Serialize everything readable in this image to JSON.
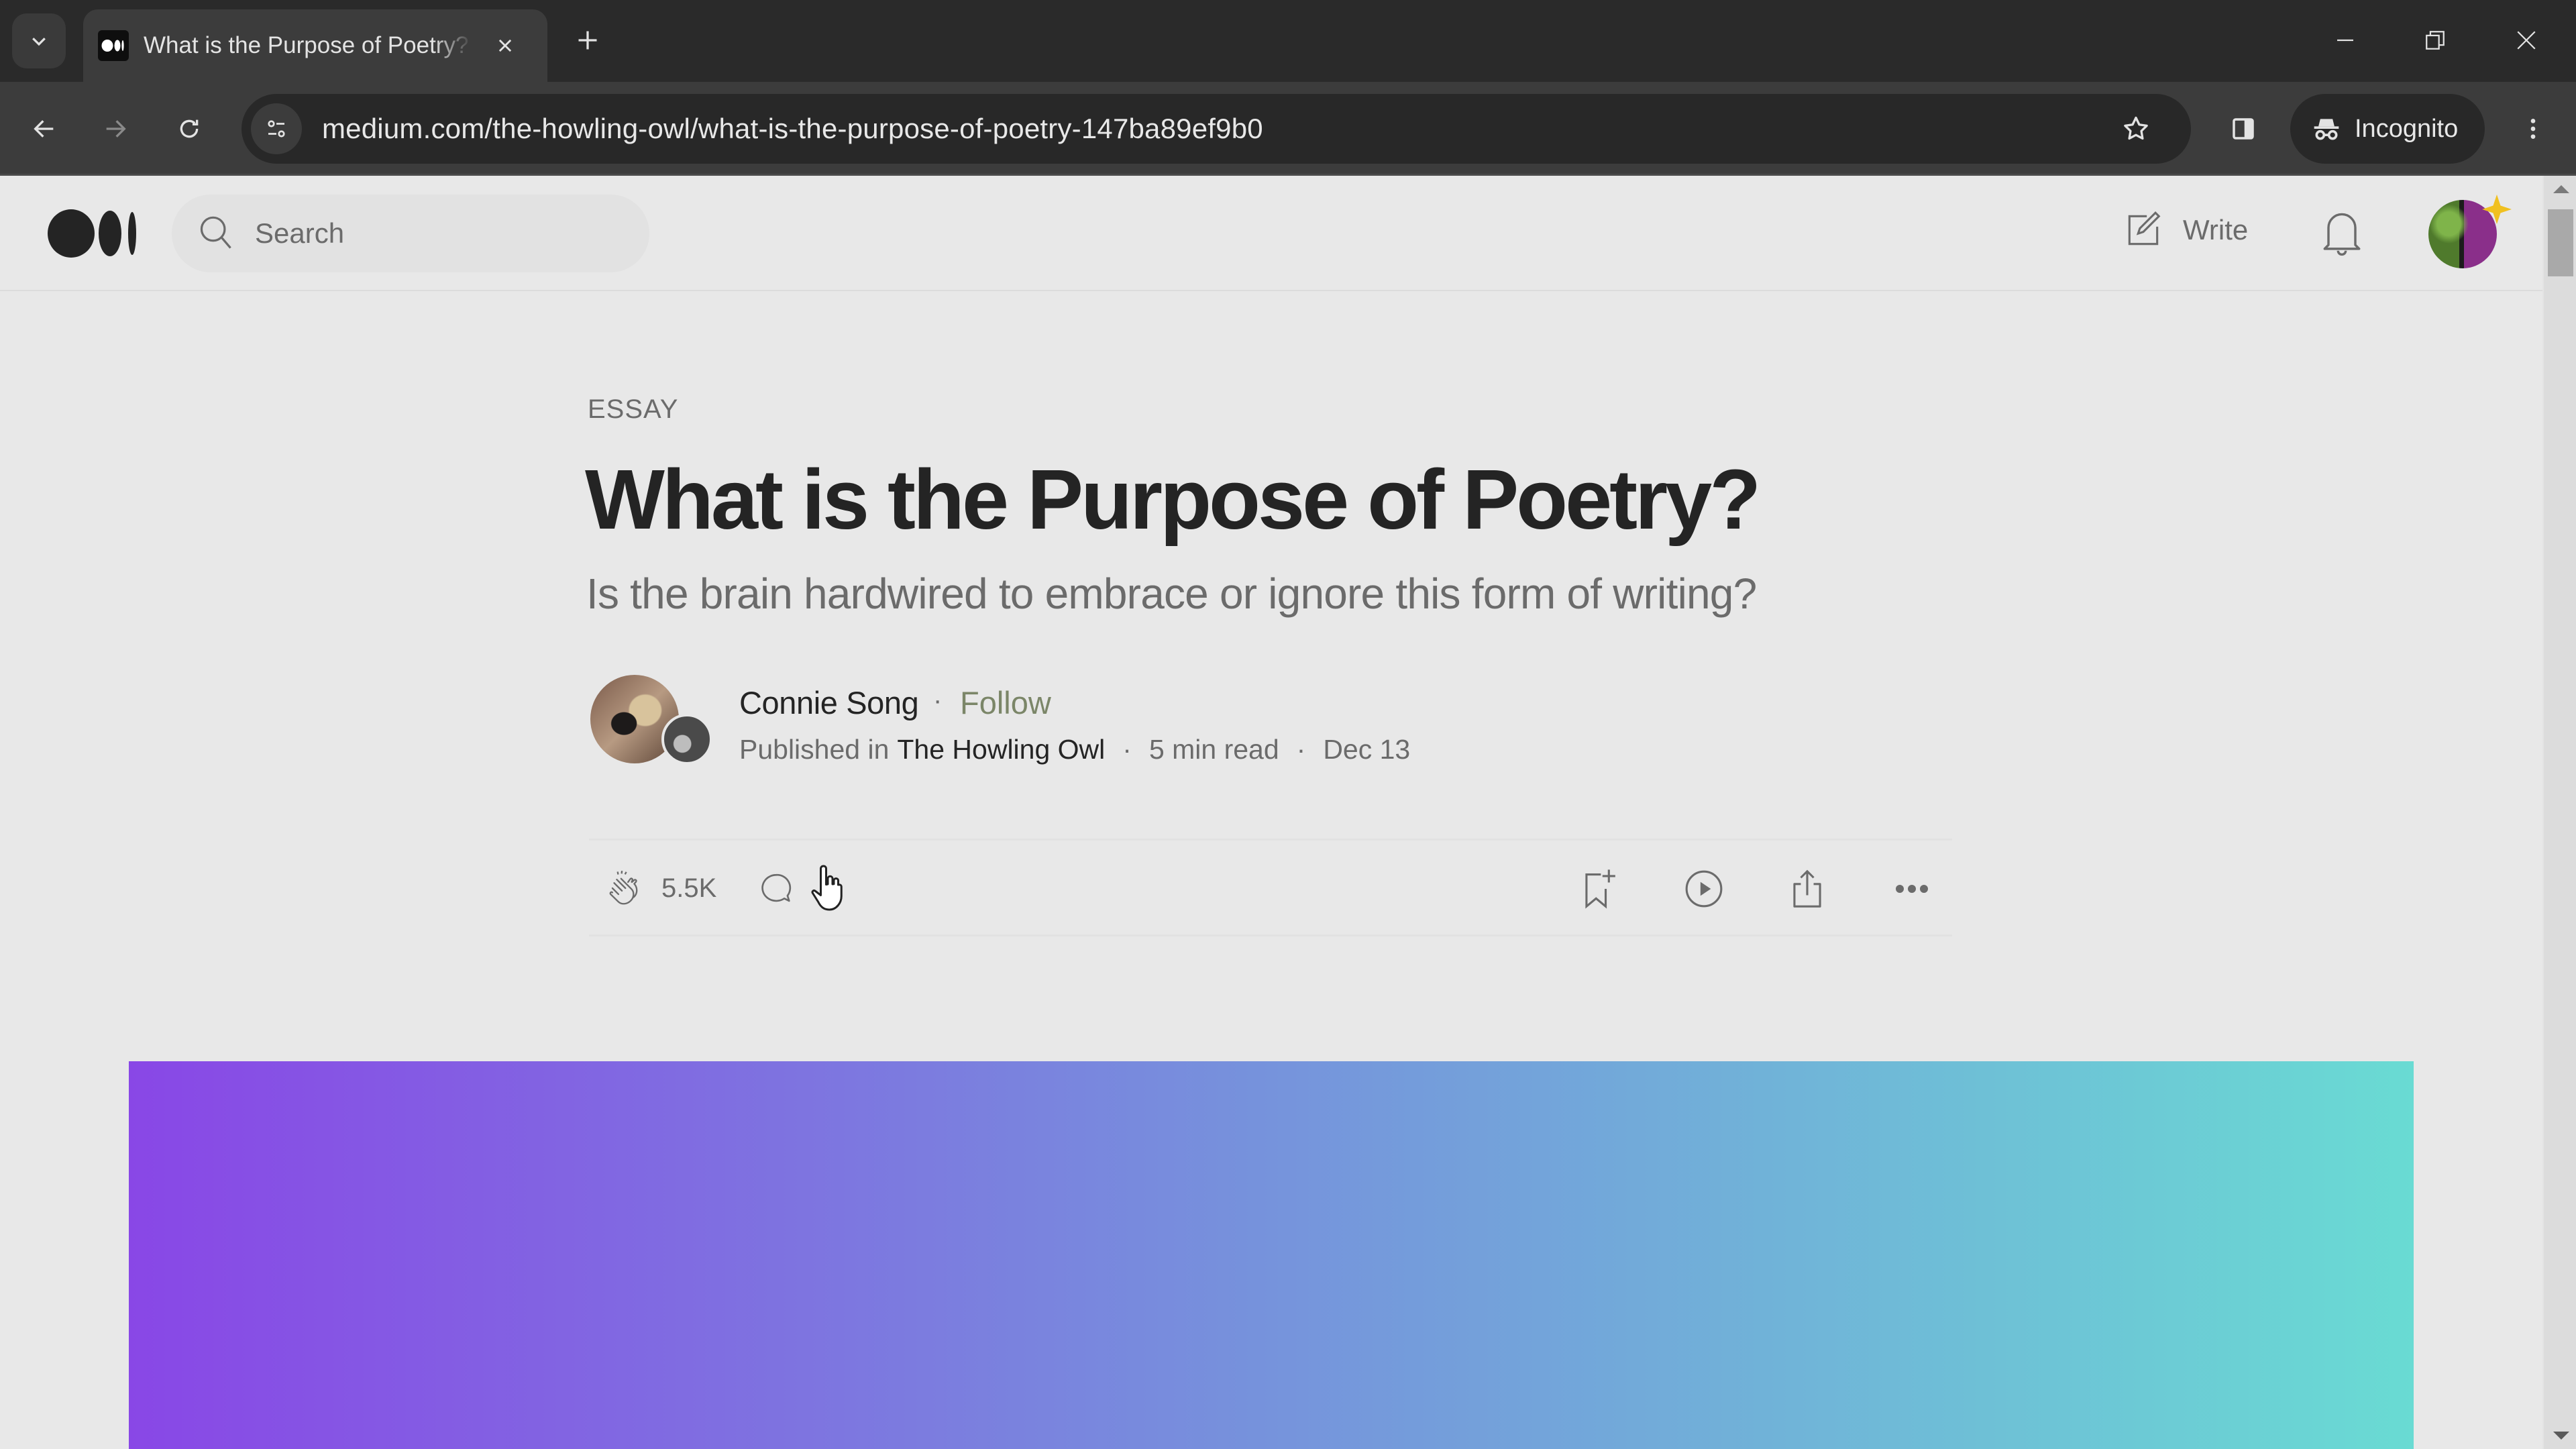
{
  "browser": {
    "tab": {
      "title": "What is the Purpose of Poetry?",
      "favicon": "medium-logo-icon"
    },
    "new_tab_label": "+",
    "url": "medium.com/the-howling-owl/what-is-the-purpose-of-poetry-147ba89ef9b0",
    "profile_label": "Incognito",
    "window_controls": [
      "minimize",
      "restore",
      "close"
    ]
  },
  "header": {
    "logo": "medium-logo-icon",
    "search_placeholder": "Search",
    "write_label": "Write"
  },
  "article": {
    "kicker": "ESSAY",
    "title": "What is the Purpose of Poetry?",
    "subtitle": "Is the brain hardwired to embrace or ignore this form of writing?",
    "author": {
      "name": "Connie Song",
      "separator": "·",
      "follow_label": "Follow"
    },
    "meta": {
      "published_in_label": "Published in",
      "publication": "The Howling Owl",
      "read_time": "5 min read",
      "date": "Dec 13",
      "separator": "·"
    },
    "actions": {
      "claps": "5.5K",
      "icons": [
        "clap-icon",
        "comment-icon",
        "bookmark-add-icon",
        "listen-play-icon",
        "share-icon",
        "more-options-icon"
      ]
    },
    "hero_image": {
      "kind": "gradient",
      "colors": [
        "#8947e6",
        "#7693dc",
        "#69dbd3"
      ]
    }
  },
  "colors": {
    "page_bg": "#e8e8e8",
    "text_primary": "#242424",
    "text_secondary": "#6b6b6b",
    "follow_accent": "#7b8668",
    "chrome_dark": "#2a2a2a"
  }
}
